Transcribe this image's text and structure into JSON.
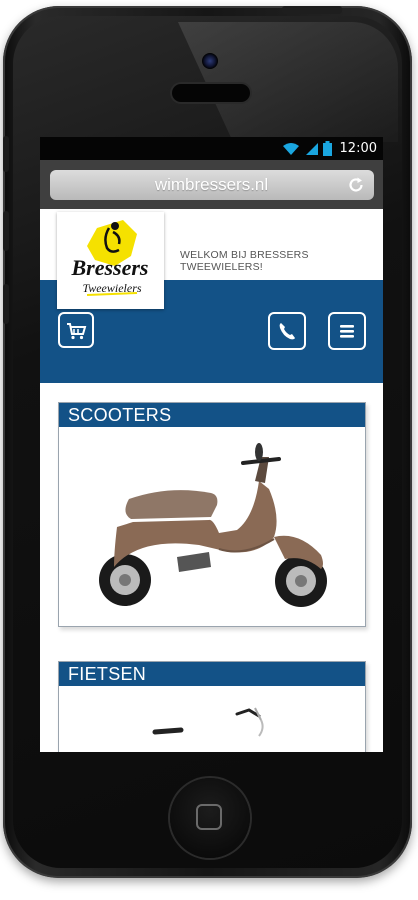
{
  "status_bar": {
    "time": "12:00",
    "icons": [
      "wifi-icon",
      "signal-icon",
      "battery-icon"
    ]
  },
  "browser": {
    "url": "wimbressers.nl",
    "reload_icon": "reload-icon"
  },
  "header": {
    "logo": {
      "brand": "Bressers",
      "subline": "Tweewielers"
    },
    "welcome_text": "WELKOM BIJ BRESSERS TWEEWIELERS!",
    "icons": {
      "cart": "cart-icon",
      "phone": "phone-icon",
      "menu": "menu-icon"
    }
  },
  "categories": [
    {
      "title": "SCOOTERS",
      "image": "scooter-image"
    },
    {
      "title": "FIETSEN",
      "image": "bicycle-image"
    }
  ],
  "colors": {
    "primary_blue": "#135287",
    "logo_yellow": "#f5e100",
    "scooter_body": "#8a6a55"
  }
}
